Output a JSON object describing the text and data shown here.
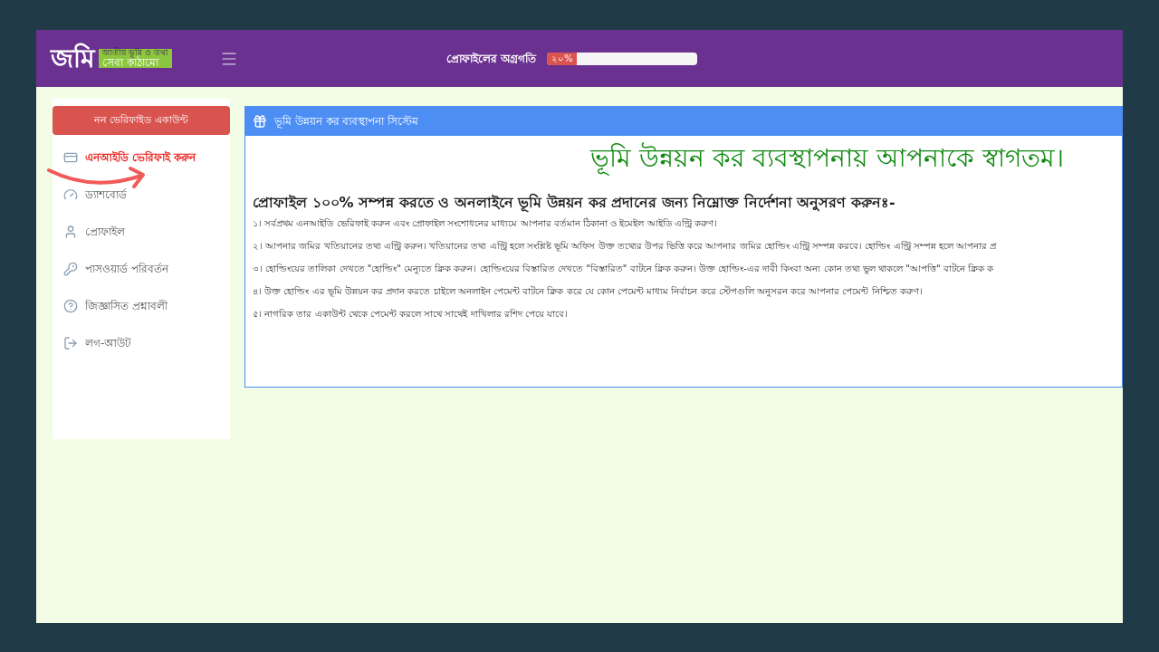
{
  "header": {
    "logo": {
      "word": "জমি",
      "tagline_top": "জাতীয় ভূমি ও তথ্য",
      "tagline_bottom": "সেবা কাঠামো"
    },
    "progress": {
      "label": "প্রোফাইলের অগ্রগতি",
      "reading": "২০%",
      "level": 0.2
    }
  },
  "sidebar": {
    "status": "নন ভেরিফাইড একাউন্ট",
    "items": [
      {
        "label": "এনআইডি ভেরিফাই করুন",
        "kind": "card",
        "highlighted": true
      },
      {
        "label": "ড্যাশবোর্ড",
        "kind": "dashboard",
        "highlighted": false
      },
      {
        "label": "প্রোফাইল",
        "kind": "user",
        "highlighted": false
      },
      {
        "label": "পাসওয়ার্ড পরিবর্তন",
        "kind": "key",
        "highlighted": false
      },
      {
        "label": "জিজ্ঞাসিত প্রশ্নাবলী",
        "kind": "question",
        "highlighted": false
      },
      {
        "label": "লগ-আউট",
        "kind": "logout",
        "highlighted": false
      }
    ]
  },
  "panel": {
    "title": "ভূমি উন্নয়ন কর ব্যবস্থাপনা সিস্টেম",
    "welcome": "ভূমি উন্নয়ন কর ব্যবস্থাপনায় আপনাকে স্বাগতম।",
    "heading": "প্রোফাইল ১০০% সম্পন্ন করতে ও অনলাইনে ভূমি উন্নয়ন কর প্রদানের জন্য নিম্নোক্ত নির্দেশনা অনুসরণ করুনঃ-",
    "steps": [
      "১। সর্বপ্রথম এনআইডি ভেরিফাই করুন এবং প্রোফাইল সংশোধনের মাধ্যমে আপনার বর্তমান ঠিকানা ও ইমেইল আইডি এন্ট্রি করুণ।",
      "২। আপনার জমির খতিয়ানের তথ্য এন্ট্রি করুন। খতিয়ানের তথ্য এন্ট্রি হলে সংশ্লিষ্ট ভূমি অফিস উক্ত তথ্যের উপর ভিত্তি করে আপনার জমির হোল্ডিং এন্ট্রি সম্পন্ন করবে। হোল্ডিং এন্ট্রি সম্পন্ন হলে আপনার প্র",
      "৩। হোল্ডিংয়ের তালিকা দেখতে \"হোল্ডিং\" মেন্যুতে ক্লিক করুন। হোল্ডিংয়ের বিস্তারিত দেখতে \"বিস্তারিত\" বাটনে ক্লিক করুন। উক্ত হোল্ডিং-এর দাবী কিংবা অন্য কোন তথ্য ভুল থাকলে \"আপত্তি\" বাটনে ক্লিক ক",
      "৪। উক্ত হোল্ডিং এর ভূমি উন্নয়ন কর প্রদান করতে চাইলে অনলাইন পেমেন্ট বাটনে ক্লিক করে যে কোন পেমেন্ট মাধ্যম নির্বাচন করে স্টেপগুলি অনুসরন করে আপনার পেমেন্ট নিশ্চিত করুণ।",
      "৫। নাগরিক তার একাউন্ট থেকে পেমেন্ট করলে সাথে সাথেই দাখিলার রশিদ পেয়ে যাবে।"
    ]
  }
}
